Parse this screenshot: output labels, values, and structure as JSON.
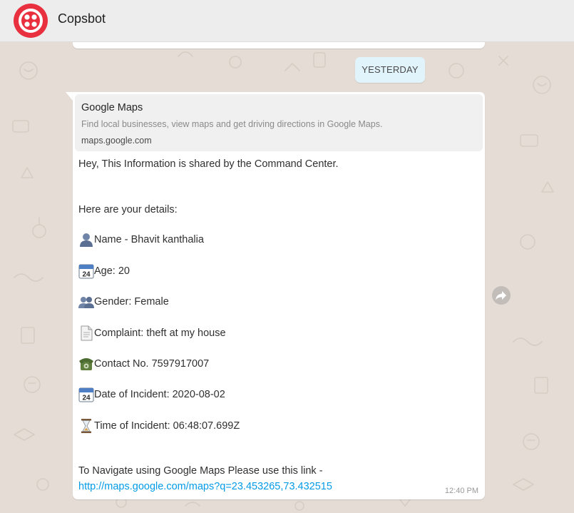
{
  "header": {
    "title": "Copsbot",
    "avatar_icon": "twilio-logo-icon",
    "avatar_color": "#e8303f"
  },
  "chat": {
    "date_chip": "YESTERDAY",
    "message": {
      "link_preview": {
        "title": "Google Maps",
        "description": "Find local businesses, view maps and get driving directions in Google Maps.",
        "domain": "maps.google.com"
      },
      "lines": {
        "greeting": "Hey, This Information is shared by the Command Center.",
        "intro": "Here are your details:",
        "name": "Name - Bhavit kanthalia",
        "age": "Age: 20",
        "gender": "Gender: Female",
        "complaint": "Complaint: theft at my house",
        "contact": "Contact No. 7597917007",
        "date": "Date of Incident: 2020-08-02",
        "time": "Time of Incident: 06:48:07.699Z",
        "navigate": "To Navigate using Google Maps Please use this link -"
      },
      "link": "http://maps.google.com/maps?q=23.453265,73.432515",
      "timestamp": "12:40 PM",
      "icons": {
        "name": "bust-in-silhouette-icon",
        "age": "calendar-icon",
        "gender": "busts-in-silhouette-icon",
        "complaint": "page-icon",
        "contact": "telephone-icon",
        "date": "calendar-icon",
        "time": "hourglass-icon"
      }
    },
    "forward_icon": "forward-icon",
    "colors": {
      "background": "#e5ddd5",
      "bubble": "#ffffff",
      "date_chip": "#e1f3fb",
      "link": "#039be5",
      "preview": "#f0f0f0"
    }
  }
}
